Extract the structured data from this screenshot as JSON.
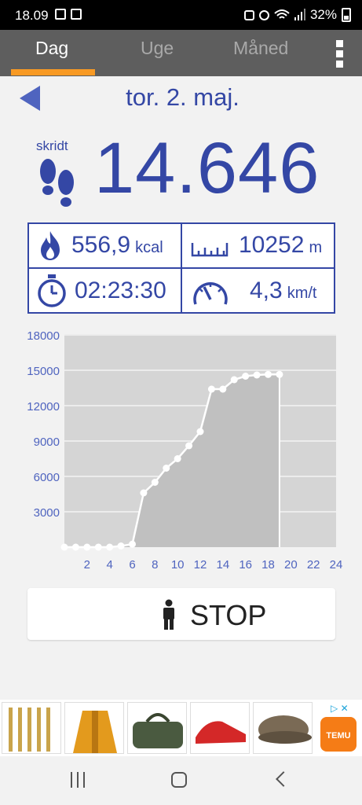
{
  "status": {
    "time": "18.09",
    "battery": "32%"
  },
  "tabs": [
    {
      "label": "Dag",
      "active": true
    },
    {
      "label": "Uge",
      "active": false
    },
    {
      "label": "Måned",
      "active": false
    }
  ],
  "date": "tor. 2. maj.",
  "steps": {
    "label": "skridt",
    "value": "14.646"
  },
  "stats": {
    "calories": {
      "value": "556,9",
      "unit": "kcal"
    },
    "distance": {
      "value": "10252",
      "unit": "m"
    },
    "duration": {
      "value": "02:23:30"
    },
    "speed": {
      "value": "4,3",
      "unit": "km/t"
    }
  },
  "chart_data": {
    "type": "area",
    "x_ticks": [
      "2",
      "4",
      "6",
      "8",
      "10",
      "12",
      "14",
      "16",
      "18",
      "20",
      "22",
      "24"
    ],
    "y_ticks": [
      "3000",
      "6000",
      "9000",
      "12000",
      "15000",
      "18000"
    ],
    "xlim": [
      0,
      24
    ],
    "ylim": [
      0,
      18000
    ],
    "grid": true,
    "series": [
      {
        "x": [
          0,
          1,
          2,
          3,
          4,
          5,
          6,
          7,
          8,
          9,
          10,
          11,
          12,
          13,
          14,
          15,
          16,
          17,
          18,
          19
        ],
        "values": [
          0,
          0,
          0,
          0,
          0,
          100,
          250,
          4600,
          5500,
          6700,
          7500,
          8600,
          9800,
          13400,
          13400,
          14200,
          14500,
          14600,
          14646,
          14646
        ]
      }
    ],
    "colors": {
      "plot_bg": "#d5d5d5",
      "fill": "#c0c0c0",
      "line": "#ffffff",
      "tick_text": "#4f64bf"
    }
  },
  "stop_button": {
    "label": "STOP"
  },
  "ad": {
    "badge": "TEMU"
  },
  "colors": {
    "accent": "#3447a5",
    "tab_indicator": "#f89a24",
    "tabbar_bg": "#5e5e5e"
  }
}
